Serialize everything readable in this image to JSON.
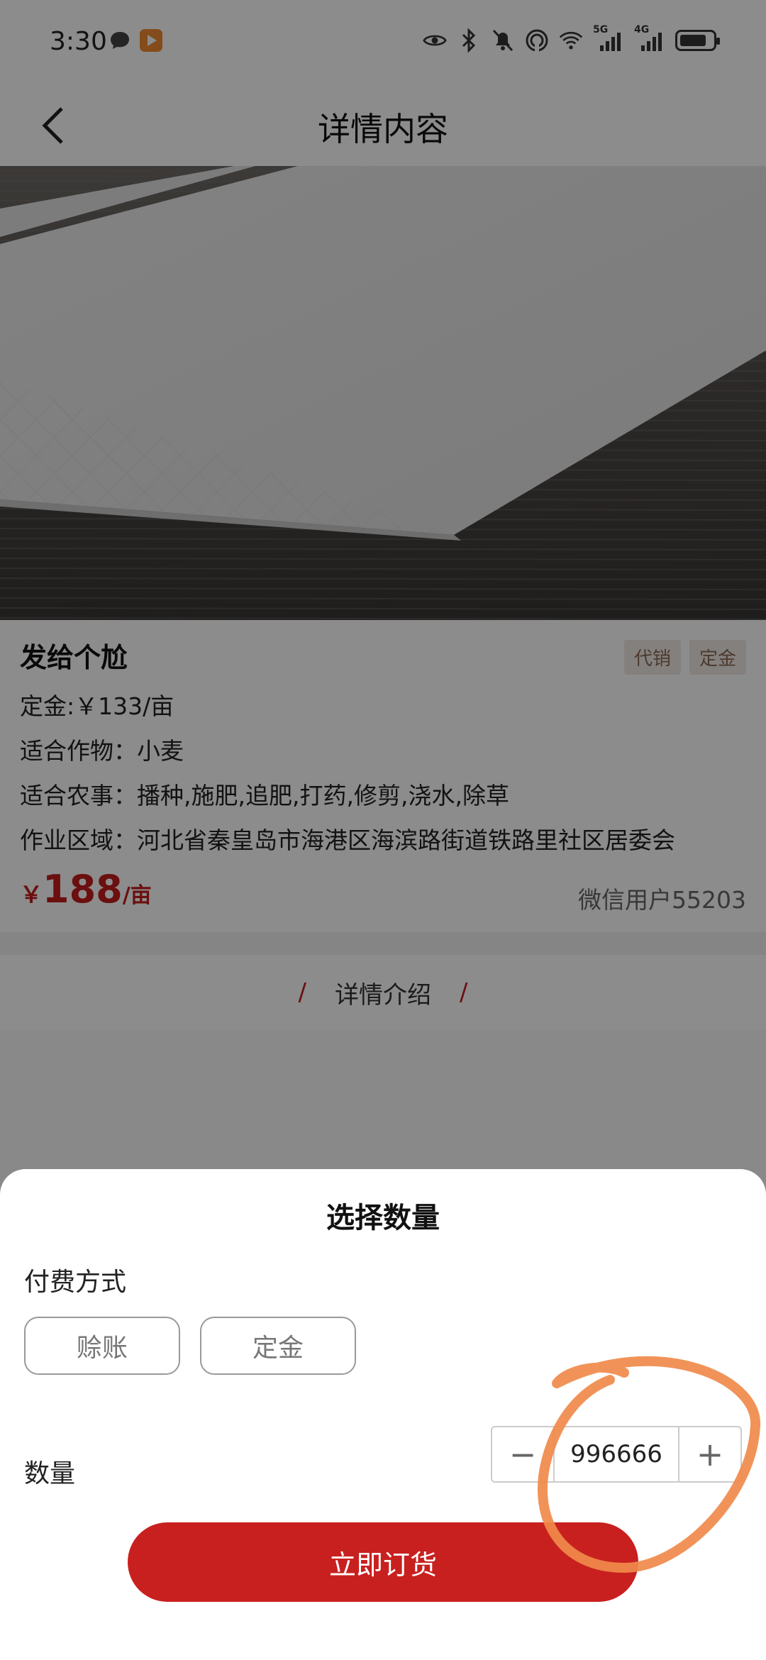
{
  "status_bar": {
    "time": "3:30",
    "icons": [
      "chat-icon",
      "video-app-icon",
      "eye-icon",
      "bluetooth-icon",
      "mute-icon",
      "nfc-icon",
      "wifi-icon",
      "signal-5g-icon",
      "signal-4g-icon",
      "battery-icon"
    ],
    "net_5g": "5G",
    "net_4g": "4G"
  },
  "header": {
    "title": "详情内容"
  },
  "product": {
    "name": "发给个尬",
    "tags": [
      "代销",
      "定金"
    ],
    "deposit": "定金:￥133/亩",
    "crop": "适合作物：小麦",
    "farm_work": "适合农事：播种,施肥,追肥,打药,修剪,浇水,除草",
    "area": "作业区域：河北省秦皇岛市海港区海滨路街道铁路里社区居委会",
    "price_currency": "￥",
    "price_value": "188",
    "price_unit": "/亩",
    "seller": "微信用户55203"
  },
  "section": {
    "slash_left": "/",
    "title": "详情介绍",
    "slash_right": "/"
  },
  "sheet": {
    "title": "选择数量",
    "pay_label": "付费方式",
    "pay_options": [
      "赊账",
      "定金"
    ],
    "qty_label": "数量",
    "qty_minus": "−",
    "qty_value": "996666",
    "qty_plus": "+",
    "order_button": "立即订货"
  },
  "colors": {
    "accent": "#c8201f",
    "annotation": "#f08a4b"
  }
}
